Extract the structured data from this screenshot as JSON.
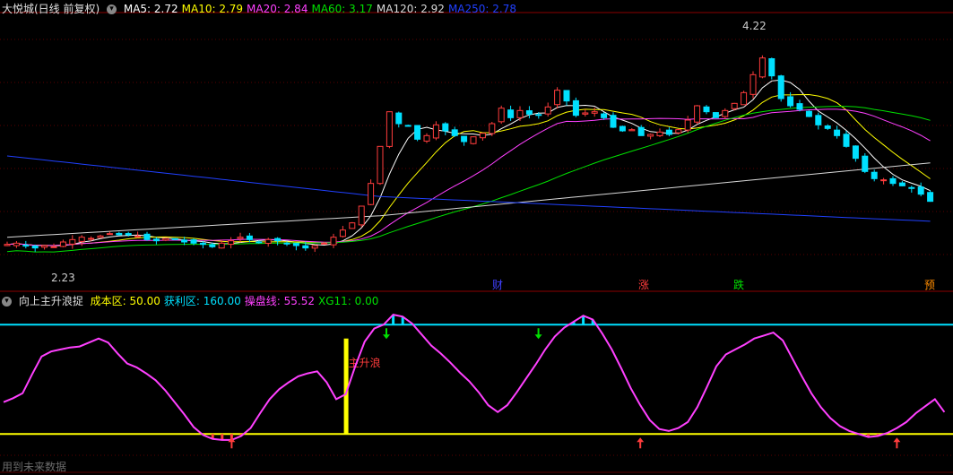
{
  "panel_top": {
    "title": "大悦城(日线 前复权)",
    "ma_labels": [
      {
        "text": "MA5: 2.72",
        "color": "#ffffff"
      },
      {
        "text": "MA10: 2.79",
        "color": "#ffff00"
      },
      {
        "text": "MA20: 2.84",
        "color": "#ff40ff"
      },
      {
        "text": "MA60: 3.17",
        "color": "#00e000"
      },
      {
        "text": "MA120: 2.92",
        "color": "#d8d8d8"
      },
      {
        "text": "MA250: 2.78",
        "color": "#2040ff"
      }
    ],
    "high_label": "4.22",
    "low_label": "2.23",
    "event_markers": [
      "财",
      "涨",
      "跌",
      "预"
    ]
  },
  "panel_bottom": {
    "title": "向上主升浪捉",
    "indicators": [
      {
        "text": "成本区: 50.00",
        "color": "#ffff00"
      },
      {
        "text": "获利区: 160.00",
        "color": "#00e0ff"
      },
      {
        "text": "操盘线: 55.52",
        "color": "#ff40ff"
      },
      {
        "text": "XG11: 0.00",
        "color": "#00e000"
      }
    ],
    "wave_label": "主升浪",
    "footnote": "用到未来数据"
  },
  "colors": {
    "up": "#ff3c3c",
    "down": "#00e0ff",
    "grid": "#8b0000",
    "cost_line": "#ffff00",
    "profit_line": "#00e0ff",
    "osc": "#ff40ff"
  },
  "chart_data": [
    {
      "type": "candlestick",
      "x_count": 100,
      "ylim": [
        2.1,
        4.35
      ],
      "close": [
        2.44,
        2.45,
        2.43,
        2.41,
        2.43,
        2.42,
        2.46,
        2.48,
        2.5,
        2.49,
        2.51,
        2.53,
        2.52,
        2.52,
        2.51,
        2.48,
        2.47,
        2.49,
        2.48,
        2.46,
        2.45,
        2.44,
        2.42,
        2.45,
        2.47,
        2.5,
        2.48,
        2.46,
        2.48,
        2.47,
        2.45,
        2.43,
        2.41,
        2.43,
        2.45,
        2.5,
        2.56,
        2.62,
        2.76,
        2.95,
        3.26,
        3.55,
        3.45,
        3.43,
        3.32,
        3.35,
        3.44,
        3.39,
        3.35,
        3.3,
        3.34,
        3.37,
        3.45,
        3.58,
        3.5,
        3.56,
        3.53,
        3.52,
        3.59,
        3.73,
        3.64,
        3.52,
        3.54,
        3.55,
        3.5,
        3.42,
        3.39,
        3.4,
        3.35,
        3.36,
        3.38,
        3.36,
        3.4,
        3.48,
        3.6,
        3.55,
        3.5,
        3.56,
        3.62,
        3.71,
        3.86,
        4.0,
        3.85,
        3.66,
        3.6,
        3.57,
        3.51,
        3.44,
        3.41,
        3.35,
        3.26,
        3.16,
        3.05,
        2.99,
        2.98,
        2.95,
        2.93,
        2.91,
        2.86,
        2.8
      ],
      "series": [
        {
          "name": "MA5",
          "value": 2.72,
          "color": "#ffffff"
        },
        {
          "name": "MA10",
          "value": 2.79,
          "color": "#ffff00"
        },
        {
          "name": "MA20",
          "value": 2.84,
          "color": "#ff40ff"
        },
        {
          "name": "MA60",
          "value": 3.17,
          "color": "#00e000"
        },
        {
          "name": "MA120",
          "value": 2.92,
          "color": "#d8d8d8"
        },
        {
          "name": "MA250",
          "value": 2.78,
          "color": "#2040ff"
        }
      ],
      "high": 4.22,
      "low": 2.23
    },
    {
      "type": "line",
      "ylim": [
        25,
        180
      ],
      "cost_zone": 50,
      "profit_zone": 160,
      "osc": [
        82,
        86,
        91,
        110,
        128,
        133,
        135,
        137,
        138,
        142,
        146,
        142,
        131,
        121,
        117,
        111,
        104,
        94,
        82,
        70,
        57,
        49,
        45,
        44,
        44,
        48,
        56,
        71,
        85,
        95,
        102,
        108,
        111,
        113,
        102,
        85,
        90,
        118,
        143,
        156,
        160,
        170,
        168,
        161,
        150,
        139,
        131,
        122,
        112,
        103,
        92,
        79,
        72,
        79,
        92,
        106,
        120,
        135,
        148,
        157,
        163,
        169,
        165,
        151,
        135,
        116,
        96,
        79,
        64,
        55,
        53,
        56,
        62,
        77,
        97,
        118,
        130,
        135,
        140,
        146,
        149,
        152,
        144,
        126,
        108,
        91,
        77,
        66,
        58,
        53,
        50,
        47,
        48,
        51,
        56,
        62,
        71,
        78,
        85,
        72
      ]
    }
  ]
}
